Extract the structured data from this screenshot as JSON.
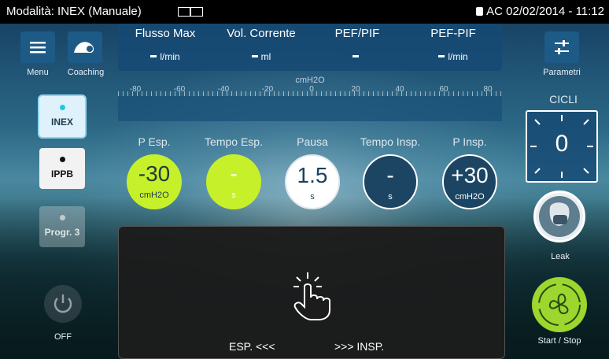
{
  "status": {
    "mode": "Modalità: INEX (Manuale)",
    "right": "AC  02/02/2014 - 11:12"
  },
  "left": {
    "menu": "Menu",
    "coaching": "Coaching",
    "off": "OFF"
  },
  "modes": [
    {
      "label": "INEX",
      "dot_color": "#1ec8e8"
    },
    {
      "label": "IPPB",
      "dot_color": "#111111"
    },
    {
      "label": "Progr. 3",
      "dot_color": "#c9c9c9"
    }
  ],
  "top": [
    {
      "header": "Flusso Max",
      "value": "l/min"
    },
    {
      "header": "Vol. Corrente",
      "value": "ml"
    },
    {
      "header": "PEF/PIF",
      "value": ""
    },
    {
      "header": "PEF-PIF",
      "value": "l/min"
    }
  ],
  "scale": {
    "unit": "cmH2O",
    "ticks": [
      "-80",
      "-60",
      "-40",
      "-20",
      "0",
      "20",
      "40",
      "60",
      "80"
    ]
  },
  "params": [
    {
      "label": "P Esp.",
      "value": "-30",
      "unit": "cmH2O",
      "style": "green"
    },
    {
      "label": "Tempo Esp.",
      "value": "-",
      "unit": "s",
      "style": "green"
    },
    {
      "label": "Pausa",
      "value": "1.5",
      "unit": "s",
      "style": "white"
    },
    {
      "label": "Tempo Insp.",
      "value": "-",
      "unit": "s",
      "style": "dark"
    },
    {
      "label": "P Insp.",
      "value": "+30",
      "unit": "cmH2O",
      "style": "dark"
    }
  ],
  "right": {
    "parametri": "Parametri",
    "cicli_label": "CICLI",
    "cicli_value": "0",
    "leak": "Leak",
    "start_stop": "Start / Stop"
  },
  "panel": {
    "esp": "ESP. <<<",
    "insp": ">>> INSP."
  },
  "colors": {
    "green": "#c6f02a",
    "accent": "#1e5a86",
    "start": "#9cd62e"
  }
}
